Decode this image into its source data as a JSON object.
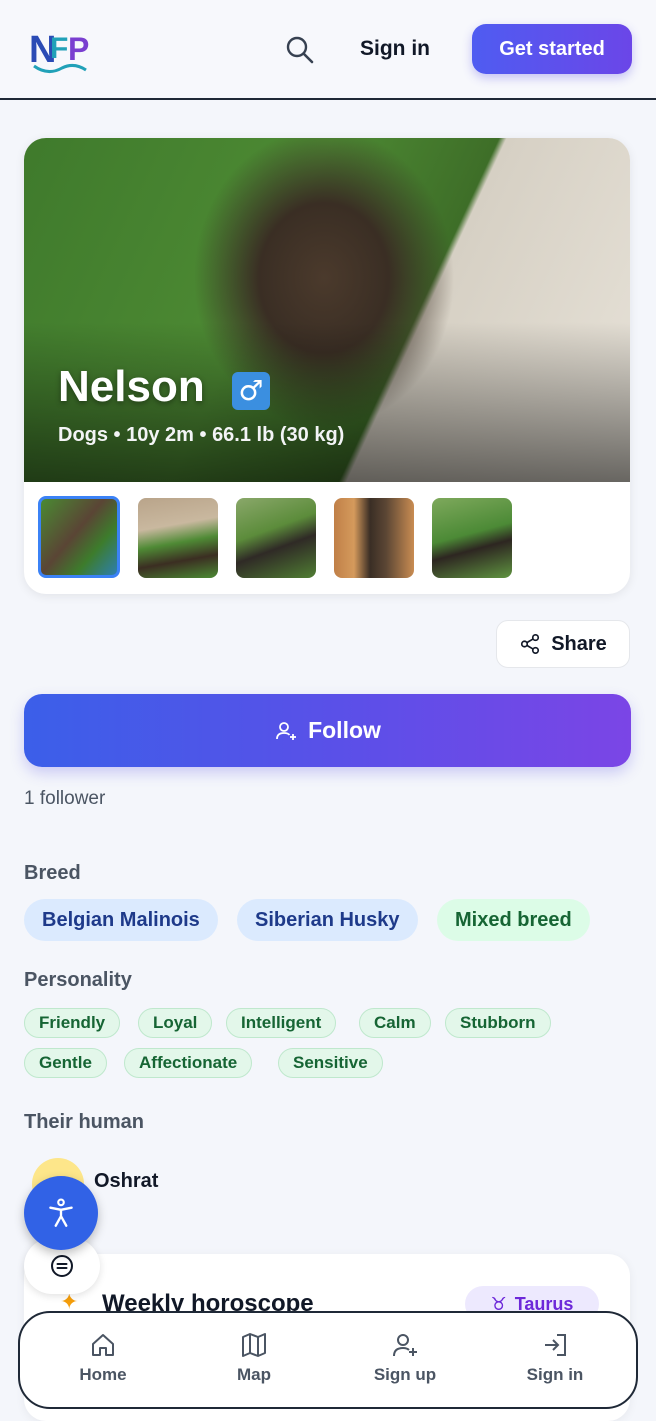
{
  "header": {
    "logo_alt": "NFP",
    "signin_label": "Sign in",
    "get_started_label": "Get started"
  },
  "pet": {
    "name": "Nelson",
    "gender_symbol": "♂",
    "meta": "Dogs • 10y 2m • 66.1 lb (30 kg)"
  },
  "actions": {
    "share_label": "Share",
    "follow_label": "Follow",
    "followers_text": "1 follower"
  },
  "breed": {
    "title": "Breed",
    "tags": [
      "Belgian Malinois",
      "Siberian Husky",
      "Mixed breed"
    ]
  },
  "personality": {
    "title": "Personality",
    "tags": [
      "Friendly",
      "Loyal",
      "Intelligent",
      "Calm",
      "Stubborn",
      "Gentle",
      "Affectionate",
      "Sensitive"
    ]
  },
  "human": {
    "title": "Their human",
    "name": "Oshrat"
  },
  "horoscope": {
    "title": "Weekly horoscope",
    "sign_symbol": "♉",
    "sign": "Taurus"
  },
  "nav": {
    "items": [
      {
        "label": "Home",
        "icon": "home-icon"
      },
      {
        "label": "Map",
        "icon": "map-icon"
      },
      {
        "label": "Sign up",
        "icon": "user-plus-icon"
      },
      {
        "label": "Sign in",
        "icon": "sign-in-icon"
      }
    ]
  },
  "colors": {
    "accent": "#4f5cf1",
    "accent_end": "#7b45e6",
    "breed_blue_bg": "#dbeafe",
    "breed_green_bg": "#dcfce7",
    "gender_blue": "#3b8fe0",
    "a11y_blue": "#3162e6"
  }
}
